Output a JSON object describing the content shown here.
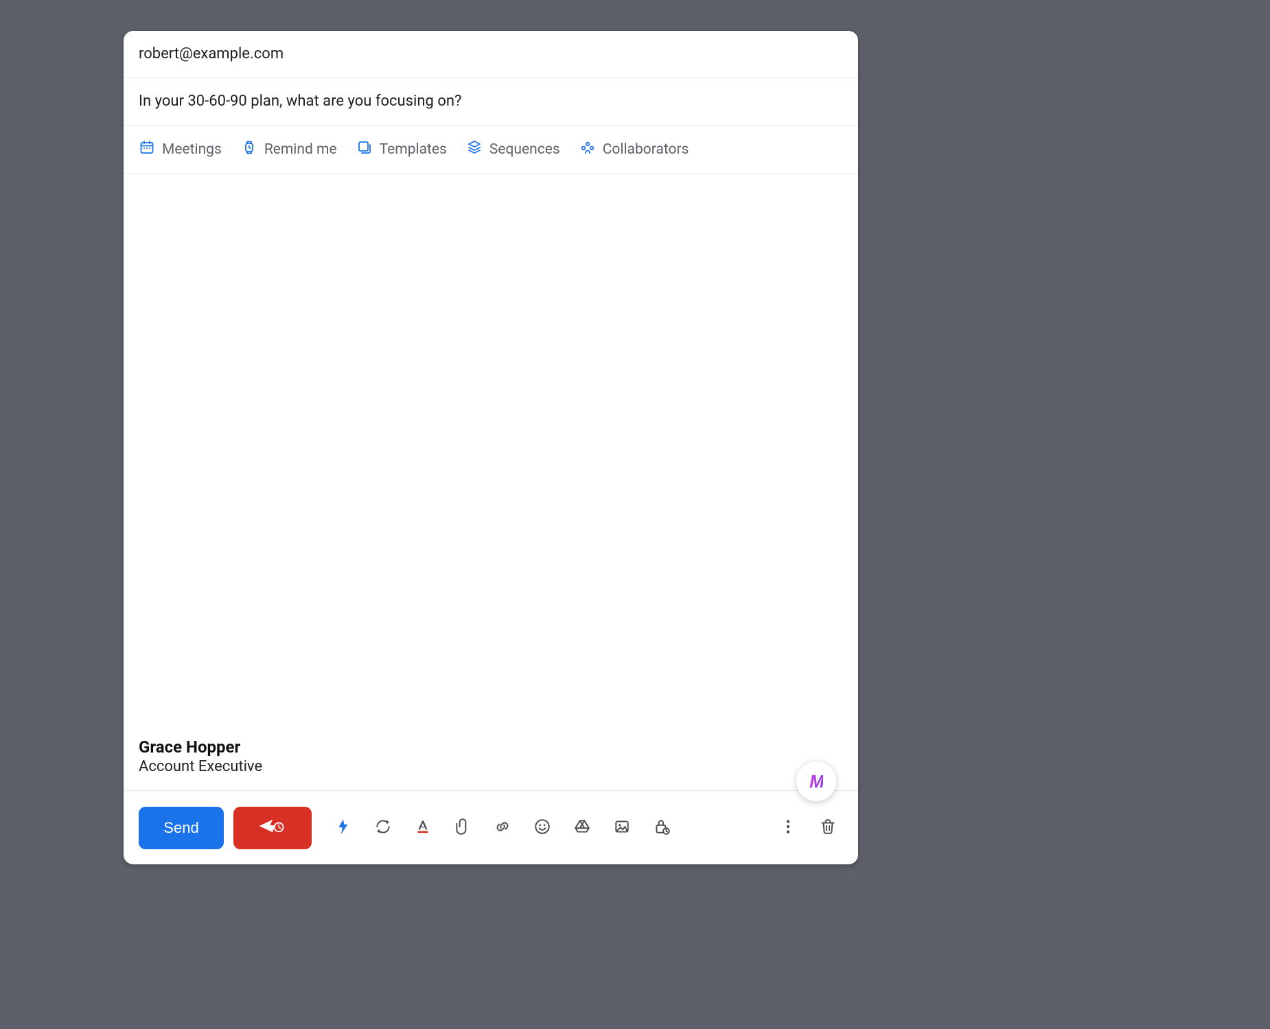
{
  "compose": {
    "to": "robert@example.com",
    "subject": "In your 30-60-90 plan, what are you focusing on?"
  },
  "tools": {
    "meetings": "Meetings",
    "remind": "Remind me",
    "templates": "Templates",
    "sequences": "Sequences",
    "collaborators": "Collaborators"
  },
  "signature": {
    "name": "Grace Hopper",
    "title": "Account Executive"
  },
  "fab": {
    "logo_text": "M"
  },
  "bottom": {
    "send_label": "Send"
  },
  "colors": {
    "primary_blue": "#1a73e8",
    "action_red": "#d93025",
    "icon_blue": "#4f86f7",
    "text": "#1f1f1f",
    "muted": "#5f6368",
    "border": "#e7e7e9"
  }
}
